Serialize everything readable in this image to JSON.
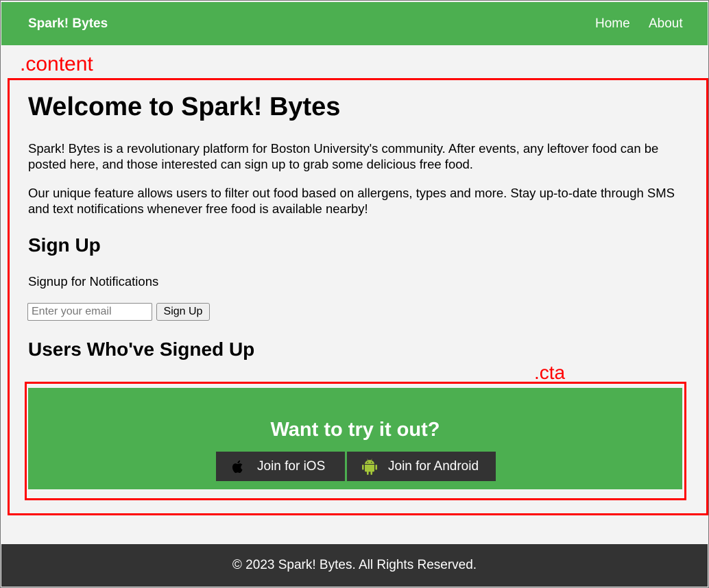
{
  "header": {
    "brand": "Spark! Bytes",
    "nav": {
      "home": "Home",
      "about": "About"
    },
    "color": "#4caf50"
  },
  "annotations": {
    "content_label": ".content",
    "cta_label": ".cta",
    "color": "#ff0000"
  },
  "main": {
    "title": "Welcome to Spark! Bytes",
    "para1": "Spark! Bytes is a revolutionary platform for Boston University's community. After events, any leftover food can be posted here, and those interested can sign up to grab some delicious free food.",
    "para2": "Our unique feature allows users to filter out food based on allergens, types and more. Stay up-to-date through SMS and text notifications whenever free food is available nearby!",
    "signup": {
      "heading": "Sign Up",
      "subtitle": "Signup for Notifications",
      "email_value": "",
      "email_placeholder": "Enter your email",
      "button": "Sign Up"
    },
    "users_heading": "Users Who've Signed Up"
  },
  "cta": {
    "title": "Want to try it out?",
    "ios": {
      "label": "Join for iOS",
      "icon": "apple-icon"
    },
    "android": {
      "label": "Join for Android",
      "icon": "android-icon",
      "icon_color": "#a4c639"
    },
    "bg_color": "#4caf50",
    "button_color": "#333333"
  },
  "footer": {
    "text": "© 2023 Spark! Bytes. All Rights Reserved.",
    "bg_color": "#333333"
  }
}
